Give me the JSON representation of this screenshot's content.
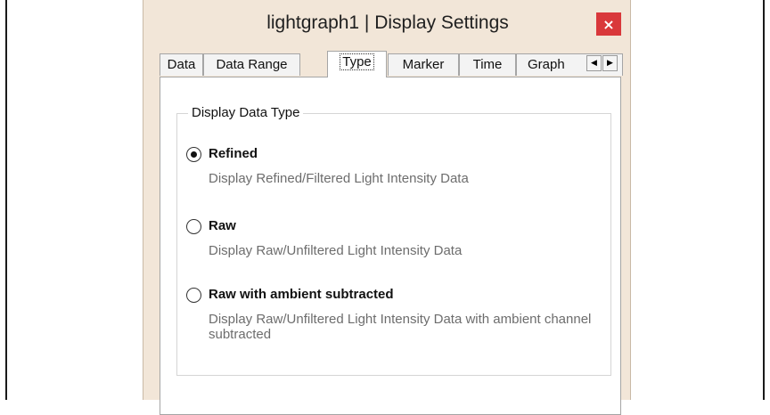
{
  "window": {
    "title": "lightgraph1 | Display Settings",
    "close_symbol": "×"
  },
  "tabs": [
    "Data",
    "Data Range",
    "Type",
    "Marker",
    "Time",
    "Graph"
  ],
  "active_tab": "Type",
  "tab_scroll": {
    "left_icon": "◀",
    "right_icon": "▶"
  },
  "group": {
    "title": "Display Data Type",
    "options": [
      {
        "label": "Refined",
        "desc": "Display Refined/Filtered Light Intensity Data",
        "checked": true
      },
      {
        "label": "Raw",
        "desc": "Display Raw/Unfiltered Light Intensity Data",
        "checked": false
      },
      {
        "label": "Raw with ambient subtracted",
        "desc": "Display Raw/Unfiltered Light Intensity Data with ambient channel subtracted",
        "checked": false
      }
    ]
  },
  "colors": {
    "window_bg": "#f2e6d8",
    "close_button": "#d9383b"
  }
}
